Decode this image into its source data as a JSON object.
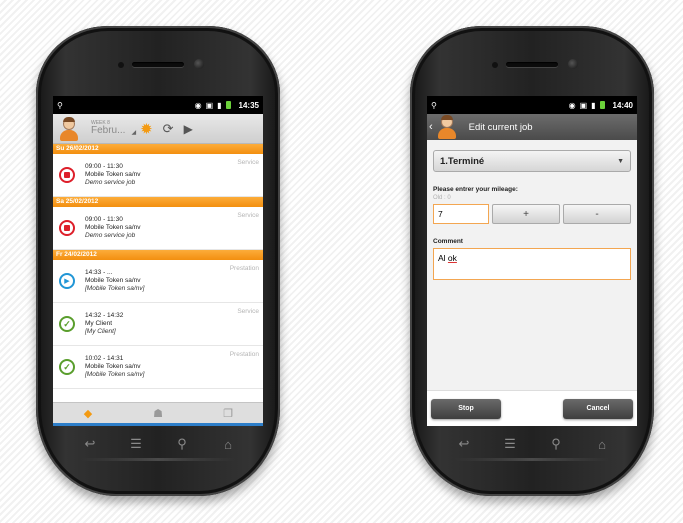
{
  "left_phone": {
    "status_bar": {
      "time": "14:35"
    },
    "app_bar": {
      "week_label": "WEEK 8",
      "month_label": "Febru...",
      "sun_icon": "sun-icon",
      "sync_icon": "sync-icon",
      "play_icon": "play-icon"
    },
    "days": [
      {
        "date": "Su 26/02/2012",
        "jobs": [
          {
            "time": "09:00 - 11:30",
            "client": "Mobile Token sa/nv",
            "desc": "Demo service job",
            "type": "Service",
            "status": "stopped"
          }
        ]
      },
      {
        "date": "Sa 25/02/2012",
        "jobs": [
          {
            "time": "09:00 - 11:30",
            "client": "Mobile Token sa/nv",
            "desc": "Demo service job",
            "type": "Service",
            "status": "stopped"
          }
        ]
      },
      {
        "date": "Fr 24/02/2012",
        "jobs": [
          {
            "time": "14:33 - ...",
            "client": "Mobile Token sa/nv",
            "desc": "[Mobile Token sa/nv]",
            "type": "Prestation",
            "status": "running"
          },
          {
            "time": "14:32 - 14:32",
            "client": "My Client",
            "desc": "[My Client]",
            "type": "Service",
            "status": "done"
          },
          {
            "time": "10:02 - 14:31",
            "client": "Mobile Token sa/nv",
            "desc": "[Mobile Token sa/nv]",
            "type": "Prestation",
            "status": "done"
          }
        ]
      }
    ],
    "bottom_tabs": [
      "jobs-tab-icon",
      "team-tab-icon",
      "documents-tab-icon"
    ]
  },
  "right_phone": {
    "status_bar": {
      "time": "14:40"
    },
    "title": "Edit current job",
    "status_value": "1.Terminé",
    "mileage_label": "Please entrer your mileage:",
    "mileage_old": "Old : 0",
    "mileage_value": "7",
    "plus_label": "+",
    "minus_label": "-",
    "comment_label": "Comment",
    "comment_value_a": "Al ",
    "comment_value_b": "ok",
    "stop_label": "Stop",
    "cancel_label": "Cancel"
  },
  "colors": {
    "accent_orange": "#f39a12",
    "stop_red": "#dd1f2a",
    "running_blue": "#2196d6",
    "done_green": "#5a9e2d"
  }
}
